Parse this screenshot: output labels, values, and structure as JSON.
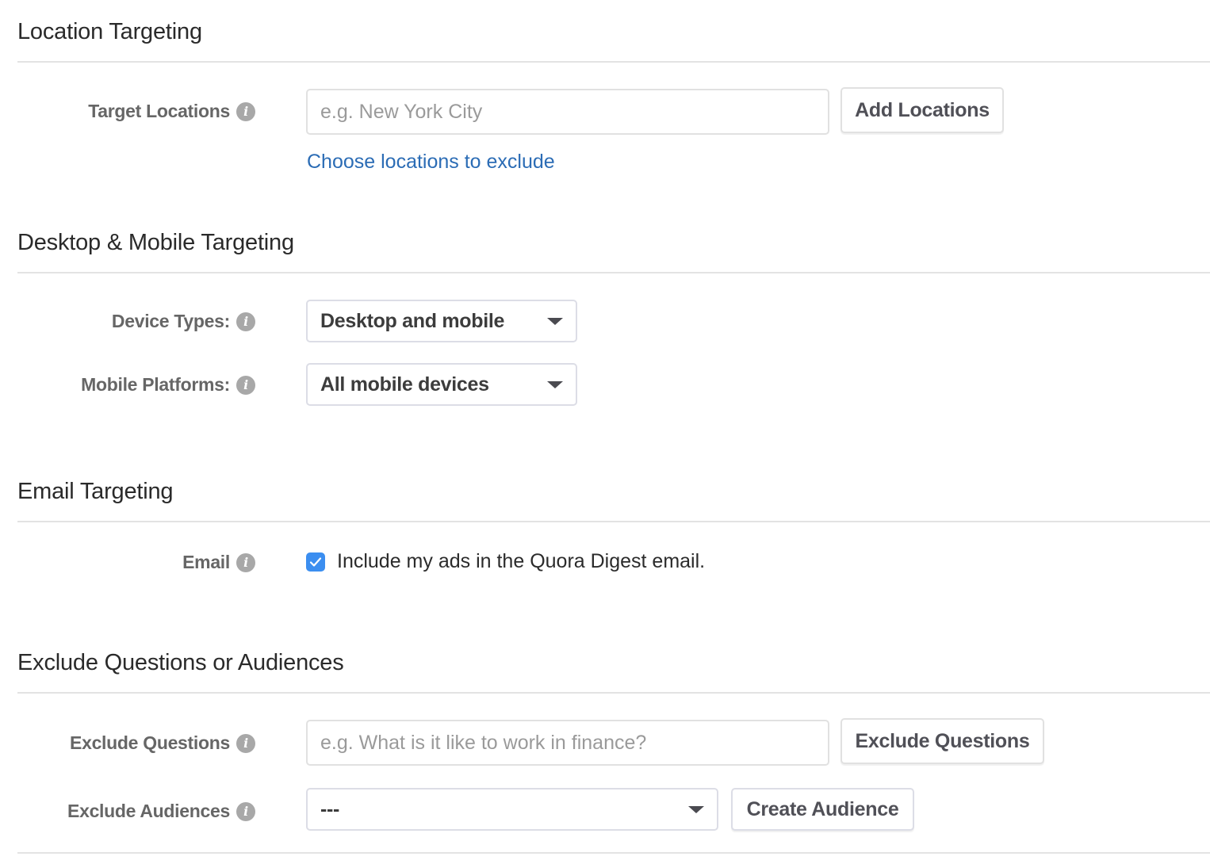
{
  "location": {
    "title": "Location Targeting",
    "target_locations": {
      "label": "Target Locations",
      "placeholder": "e.g. New York City",
      "value": "",
      "button": "Add Locations"
    },
    "exclude_link": "Choose locations to exclude"
  },
  "device": {
    "title": "Desktop & Mobile Targeting",
    "device_types": {
      "label": "Device Types:",
      "selected": "Desktop and mobile"
    },
    "mobile_platforms": {
      "label": "Mobile Platforms:",
      "selected": "All mobile devices"
    }
  },
  "email": {
    "title": "Email Targeting",
    "label": "Email",
    "checkbox_label": "Include my ads in the Quora Digest email.",
    "checked": true
  },
  "exclude": {
    "title": "Exclude Questions or Audiences",
    "questions": {
      "label": "Exclude Questions",
      "placeholder": "e.g. What is it like to work in finance?",
      "value": "",
      "button": "Exclude Questions"
    },
    "audiences": {
      "label": "Exclude Audiences",
      "selected": "---",
      "button": "Create Audience"
    }
  },
  "colors": {
    "link": "#2b6cb5",
    "checkbox": "#3b8ef0",
    "info_icon": "#a8a8a8"
  }
}
